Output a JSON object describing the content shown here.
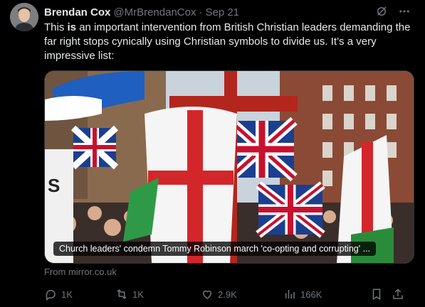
{
  "tweet": {
    "author_name": "Brendan Cox",
    "author_handle": "@MrBrendanCox",
    "separator": "·",
    "date": "Sep 21",
    "text_part1": "This ",
    "text_bold": "is",
    "text_part2": " an important intervention from British Christian leaders demanding the far right stops cynically using Christian symbols to divide us. It’s a very impressive list:"
  },
  "media": {
    "caption": "Church leaders' condemn Tommy Robinson march 'co-opting and corrupting' ...",
    "source": "From mirror.co.uk"
  },
  "actions": {
    "replies": "1K",
    "reposts": "1K",
    "likes": "2.9K",
    "views": "166K"
  }
}
